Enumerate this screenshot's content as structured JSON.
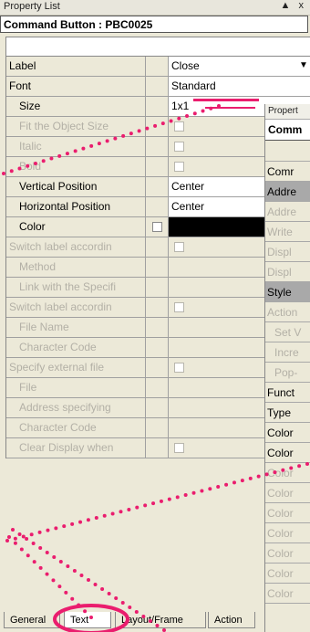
{
  "window": {
    "title": "Property List",
    "controls": "▲ x"
  },
  "header": {
    "title": "Command Button : PBC0025"
  },
  "rows": [
    {
      "name": "Label",
      "value": "Close",
      "state": "en",
      "indent": false,
      "checkbox": "none",
      "dropdown": true
    },
    {
      "name": "Font",
      "value": "Standard",
      "state": "en",
      "indent": false,
      "checkbox": "none"
    },
    {
      "name": "Size",
      "value": "1x1",
      "state": "en",
      "indent": true,
      "checkbox": "none"
    },
    {
      "name": "Fit the Object Size",
      "value": "",
      "state": "dis",
      "indent": true,
      "checkbox": "val"
    },
    {
      "name": "Italic",
      "value": "",
      "state": "dis",
      "indent": true,
      "checkbox": "val"
    },
    {
      "name": "Bold",
      "value": "",
      "state": "dis",
      "indent": true,
      "checkbox": "val"
    },
    {
      "name": "Vertical Position",
      "value": "Center",
      "state": "en",
      "indent": true,
      "checkbox": "none"
    },
    {
      "name": "Horizontal Position",
      "value": "Center",
      "state": "en",
      "indent": true,
      "checkbox": "none"
    },
    {
      "name": "Color",
      "value": "",
      "state": "en",
      "indent": true,
      "checkbox": "mid",
      "color": "#000000"
    },
    {
      "name": "Switch label accordin",
      "value": "",
      "state": "dis",
      "indent": false,
      "checkbox": "val"
    },
    {
      "name": "Method",
      "value": "",
      "state": "dis",
      "indent": true,
      "checkbox": "none"
    },
    {
      "name": "Link with the Specifi",
      "value": "",
      "state": "dis",
      "indent": true,
      "checkbox": "none"
    },
    {
      "name": "Switch label accordin",
      "value": "",
      "state": "dis",
      "indent": false,
      "checkbox": "val"
    },
    {
      "name": "File Name",
      "value": "",
      "state": "dis",
      "indent": true,
      "checkbox": "none"
    },
    {
      "name": "Character Code",
      "value": "",
      "state": "dis",
      "indent": true,
      "checkbox": "none"
    },
    {
      "name": "Specify external file",
      "value": "",
      "state": "dis",
      "indent": false,
      "checkbox": "val"
    },
    {
      "name": "File",
      "value": "",
      "state": "dis",
      "indent": true,
      "checkbox": "none"
    },
    {
      "name": "Address specifying",
      "value": "",
      "state": "dis",
      "indent": true,
      "checkbox": "none"
    },
    {
      "name": "Character Code",
      "value": "",
      "state": "dis",
      "indent": true,
      "checkbox": "none"
    },
    {
      "name": "Clear Display when",
      "value": "",
      "state": "dis",
      "indent": true,
      "checkbox": "val"
    }
  ],
  "panel2": {
    "title": "Propert",
    "header": "Comm",
    "rows": [
      {
        "t": "Comr",
        "s": ""
      },
      {
        "t": "Addre",
        "s": "sel"
      },
      {
        "t": "Addre",
        "s": "dis"
      },
      {
        "t": "Write",
        "s": "dis"
      },
      {
        "t": "Displ",
        "s": "dis"
      },
      {
        "t": "Displ",
        "s": "dis"
      },
      {
        "t": "Style",
        "s": "sel"
      },
      {
        "t": "Action",
        "s": "dis"
      },
      {
        "t": "Set V",
        "s": "dis ind"
      },
      {
        "t": "Incre",
        "s": "dis ind"
      },
      {
        "t": "Pop-",
        "s": "dis ind"
      },
      {
        "t": "Funct",
        "s": ""
      },
      {
        "t": "Type",
        "s": ""
      },
      {
        "t": "Color",
        "s": ""
      },
      {
        "t": "Color",
        "s": ""
      },
      {
        "t": "Color",
        "s": "dis"
      },
      {
        "t": "Color",
        "s": "dis"
      },
      {
        "t": "Color",
        "s": "dis"
      },
      {
        "t": "Color",
        "s": "dis"
      },
      {
        "t": "Color",
        "s": "dis"
      },
      {
        "t": "Color",
        "s": "dis"
      },
      {
        "t": "Color",
        "s": "dis"
      }
    ]
  },
  "tabs": [
    {
      "label": "General",
      "active": false
    },
    {
      "label": "Text",
      "active": true
    },
    {
      "label": "Layout/Frame",
      "active": false
    },
    {
      "label": "Action",
      "active": false
    }
  ],
  "annotation_color": "#ea1d6e"
}
